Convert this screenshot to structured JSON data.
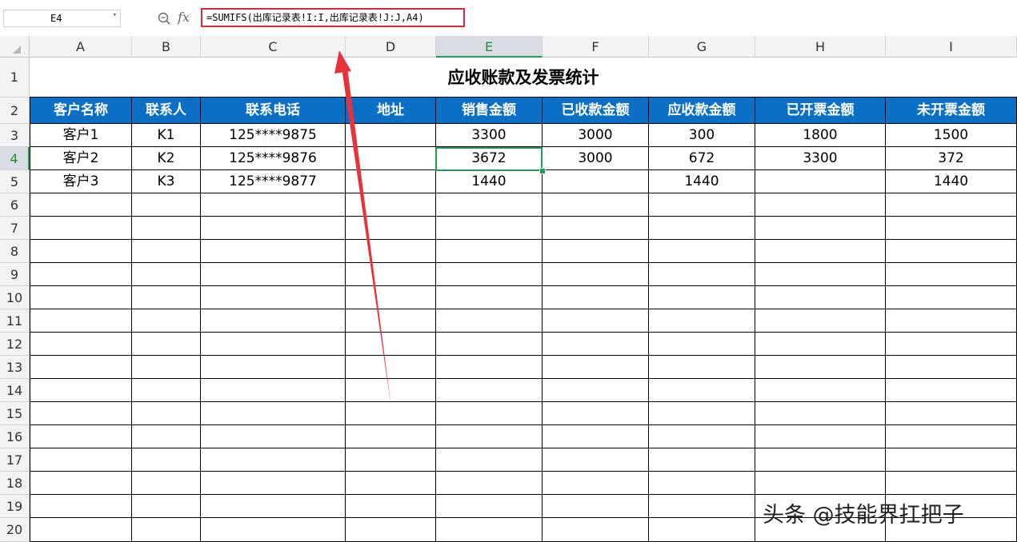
{
  "formula_bar": {
    "name_box": "E4",
    "formula": "=SUMIFS(出库记录表!I:I,出库记录表!J:J,A4)"
  },
  "columns": [
    "A",
    "B",
    "C",
    "D",
    "E",
    "F",
    "G",
    "H",
    "I"
  ],
  "selected_column": "E",
  "rows": [
    "1",
    "2",
    "3",
    "4",
    "5",
    "6",
    "7",
    "8",
    "9",
    "10",
    "11",
    "12",
    "13",
    "14",
    "15",
    "16",
    "17",
    "18",
    "19",
    "20"
  ],
  "selected_row": "4",
  "sheet": {
    "title": "应收账款及发票统计",
    "headers": [
      "客户名称",
      "联系人",
      "联系电话",
      "地址",
      "销售金额",
      "已收款金额",
      "应收款金额",
      "已开票金额",
      "未开票金额"
    ],
    "data": [
      [
        "客户1",
        "K1",
        "125****9875",
        "",
        "3300",
        "3000",
        "300",
        "1800",
        "1500"
      ],
      [
        "客户2",
        "K2",
        "125****9876",
        "",
        "3672",
        "3000",
        "672",
        "3300",
        "372"
      ],
      [
        "客户3",
        "K3",
        "125****9877",
        "",
        "1440",
        "",
        "1440",
        "",
        "1440"
      ]
    ]
  },
  "colors": {
    "header_fill": "#0b6fc6",
    "selection": "#1e9e50",
    "annotation": "#e0263a"
  },
  "icons": {
    "zoom": "zoom-in-icon",
    "fx": "fx-icon"
  },
  "fx_label": "fx",
  "watermark": "头条 @技能界扛把子"
}
